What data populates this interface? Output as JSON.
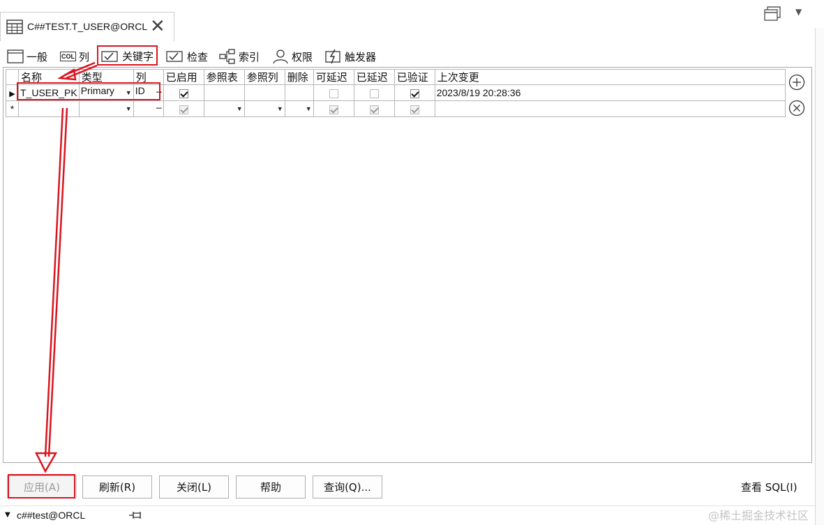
{
  "tab": {
    "title": "C##TEST.T_USER@ORCL",
    "close_icon": "close-icon",
    "icon": "table-icon"
  },
  "subtabs": [
    {
      "label": "一般",
      "icon": "window-icon"
    },
    {
      "label": "列",
      "icon": "col-icon"
    },
    {
      "label": "关键字",
      "icon": "key-icon"
    },
    {
      "label": "检查",
      "icon": "check-icon"
    },
    {
      "label": "索引",
      "icon": "index-icon"
    },
    {
      "label": "权限",
      "icon": "user-icon"
    },
    {
      "label": "触发器",
      "icon": "trigger-icon"
    }
  ],
  "col_icon_text": "COL",
  "grid": {
    "columns": [
      "名称",
      "类型",
      "列",
      "已启用",
      "参照表",
      "参照列",
      "删除",
      "可延迟",
      "已延迟",
      "已验证",
      "上次变更"
    ],
    "row1": {
      "name": "T_USER_PK",
      "type": "Primary",
      "column": "ID",
      "ellipsis": "···",
      "last_changed": "2023/8/19 20:28:36"
    },
    "new_row_marker": "*"
  },
  "buttons": {
    "apply": "应用(A)",
    "refresh": "刷新(R)",
    "close": "关闭(L)",
    "help": "帮助",
    "query": "查询(Q)...",
    "view_sql": "查看 SQL(I)"
  },
  "status": {
    "connection": "c##test@ORCL"
  },
  "watermark": "@稀土掘金技术社区",
  "colors": {
    "annotation": "#d9141e",
    "border": "#b5b5b5"
  }
}
